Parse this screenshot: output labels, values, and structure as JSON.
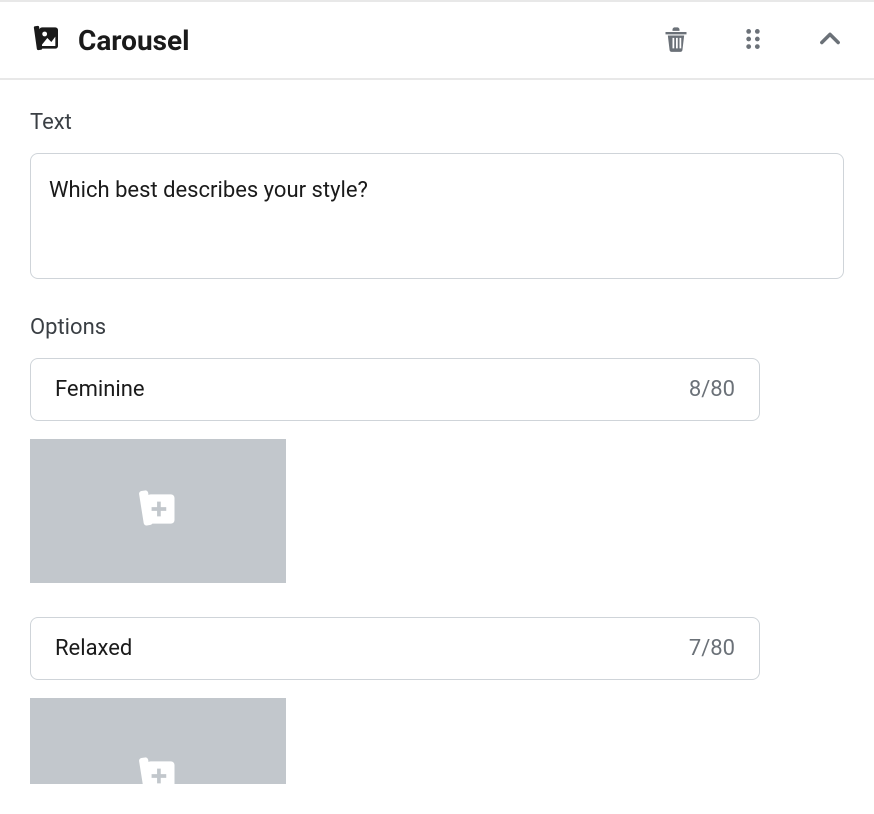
{
  "header": {
    "title": "Carousel"
  },
  "text_section": {
    "label": "Text",
    "value": "Which best describes your style?"
  },
  "options_section": {
    "label": "Options",
    "items": [
      {
        "value": "Feminine",
        "count": "8/80"
      },
      {
        "value": "Relaxed",
        "count": "7/80"
      }
    ]
  }
}
